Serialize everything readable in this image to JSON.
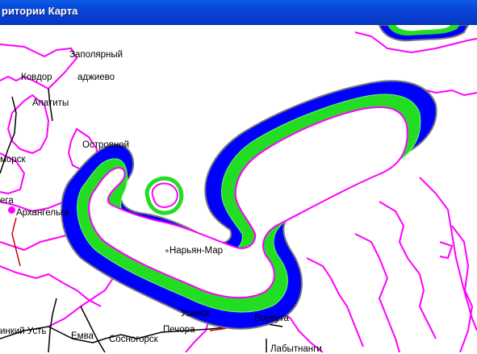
{
  "window": {
    "title": "ритории Карта"
  },
  "map": {
    "labels": {
      "zapolyarny": "Заполярный",
      "kovdor": "Ковдор",
      "zapolyarny_partial": "аджиево",
      "apatity": "Апатиты",
      "ostrovnoy": "Островной",
      "belomorsk_partial": "морск",
      "onega_partial": "ега",
      "arkhangelsk": "Архангельск",
      "naryan_mar": "Нарьян-Мар",
      "usinsk": "Усинск",
      "pechora": "Печора",
      "vorkuta": "Воркута",
      "ukhta_partial": "инкий Усть",
      "emva": "Емва",
      "sosnogorsk": "Сосногорск",
      "labytnangi": "Лабытнанги"
    },
    "colors": {
      "coastline": "#ff00ff",
      "buffer_outer": "#0000ff",
      "buffer_middle": "#00ee00",
      "buffer_inner_border": "#ff00ff",
      "roads": "#000000",
      "rail": "#cc0000",
      "title_bar": "#0846d8"
    }
  }
}
